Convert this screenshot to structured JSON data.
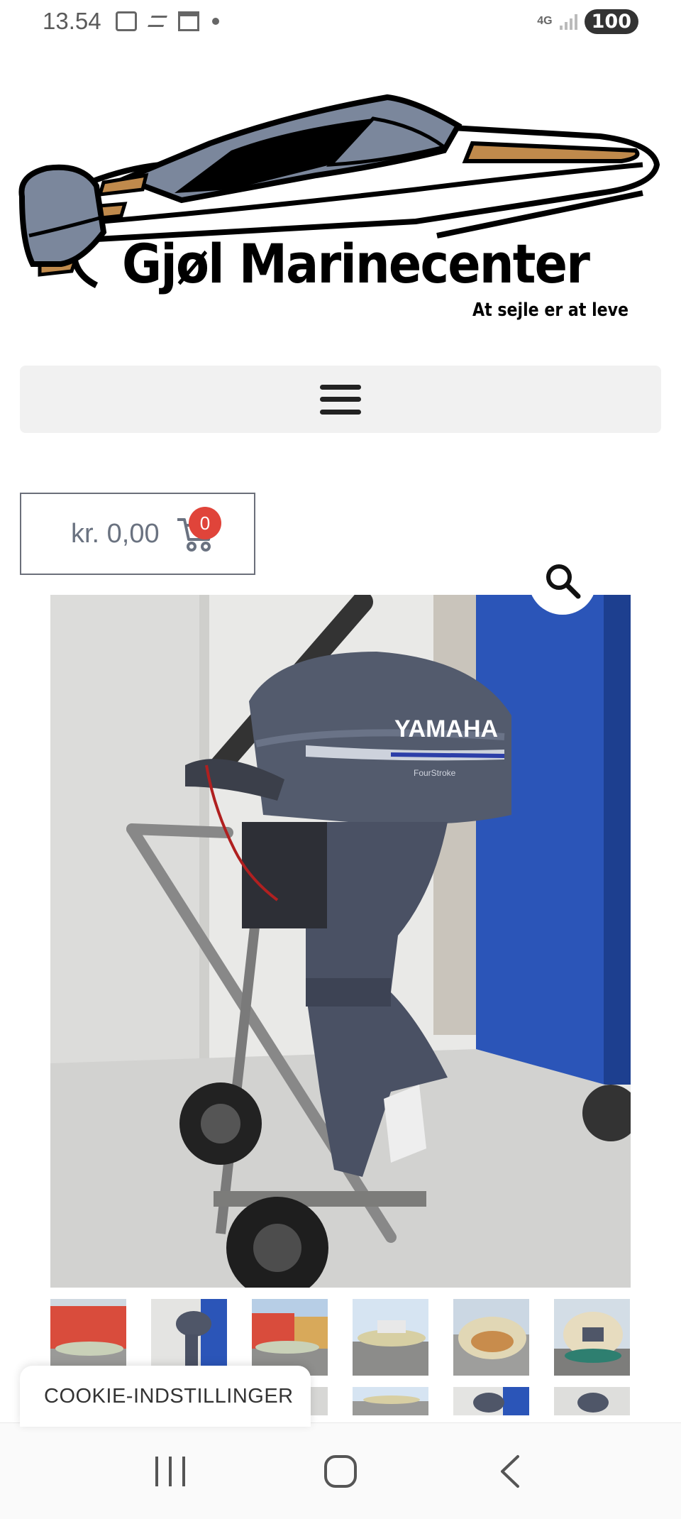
{
  "status_bar": {
    "time": "13.54",
    "network": "4G",
    "battery": "100",
    "icons": [
      "screenshot-icon",
      "notes-icon",
      "calendar-icon",
      "dot-icon",
      "network-icon",
      "signal-icon",
      "battery-icon"
    ]
  },
  "logo": {
    "title": "Gjøl Marinecenter",
    "tagline": "At sejle er at leve"
  },
  "nav": {
    "menu_icon": "hamburger-icon"
  },
  "cart": {
    "total": "kr. 0,00",
    "count": "0",
    "icon": "cart-icon"
  },
  "product": {
    "zoom_icon": "search-icon",
    "thumbnails_count": 12
  },
  "cookie": {
    "label": "COOKIE-INDSTILLINGER"
  },
  "system_nav": {
    "buttons": [
      "recents-icon",
      "home-icon",
      "back-icon"
    ]
  },
  "colors": {
    "accent_badge": "#e0443a",
    "menu_bg": "#f1f1f1",
    "boat_gray": "#7b879c",
    "boat_tan": "#c08a4c"
  }
}
